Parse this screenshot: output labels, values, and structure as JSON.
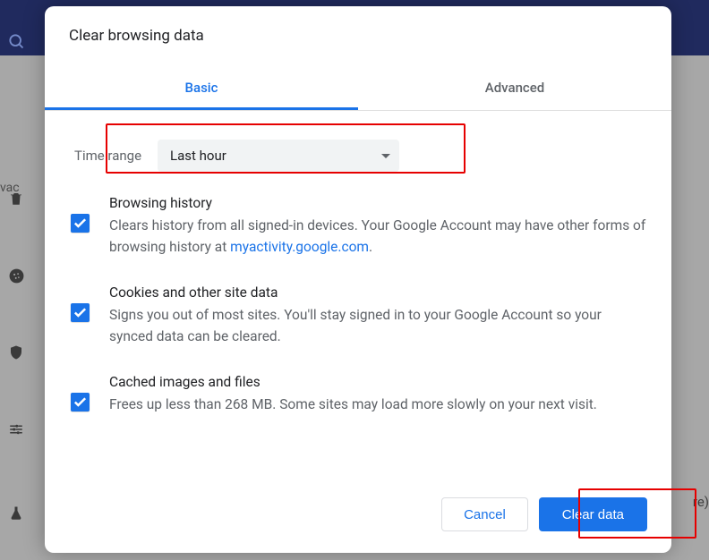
{
  "dialog": {
    "title": "Clear browsing data",
    "tabs": {
      "basic": "Basic",
      "advanced": "Advanced"
    },
    "time_label": "Time range",
    "time_value": "Last hour",
    "options": {
      "browsing": {
        "title": "Browsing history",
        "desc_before": "Clears history from all signed-in devices. Your Google Account may have other forms of browsing history at ",
        "link_text": "myactivity.google.com",
        "desc_after": "."
      },
      "cookies": {
        "title": "Cookies and other site data",
        "desc": "Signs you out of most sites. You'll stay signed in to your Google Account so your synced data can be cleared."
      },
      "cache": {
        "title": "Cached images and files",
        "desc": "Frees up less than 268 MB. Some sites may load more slowly on your next visit."
      }
    },
    "cancel": "Cancel",
    "clear": "Clear data"
  },
  "bg": {
    "label": "vac",
    "re": "re)"
  }
}
